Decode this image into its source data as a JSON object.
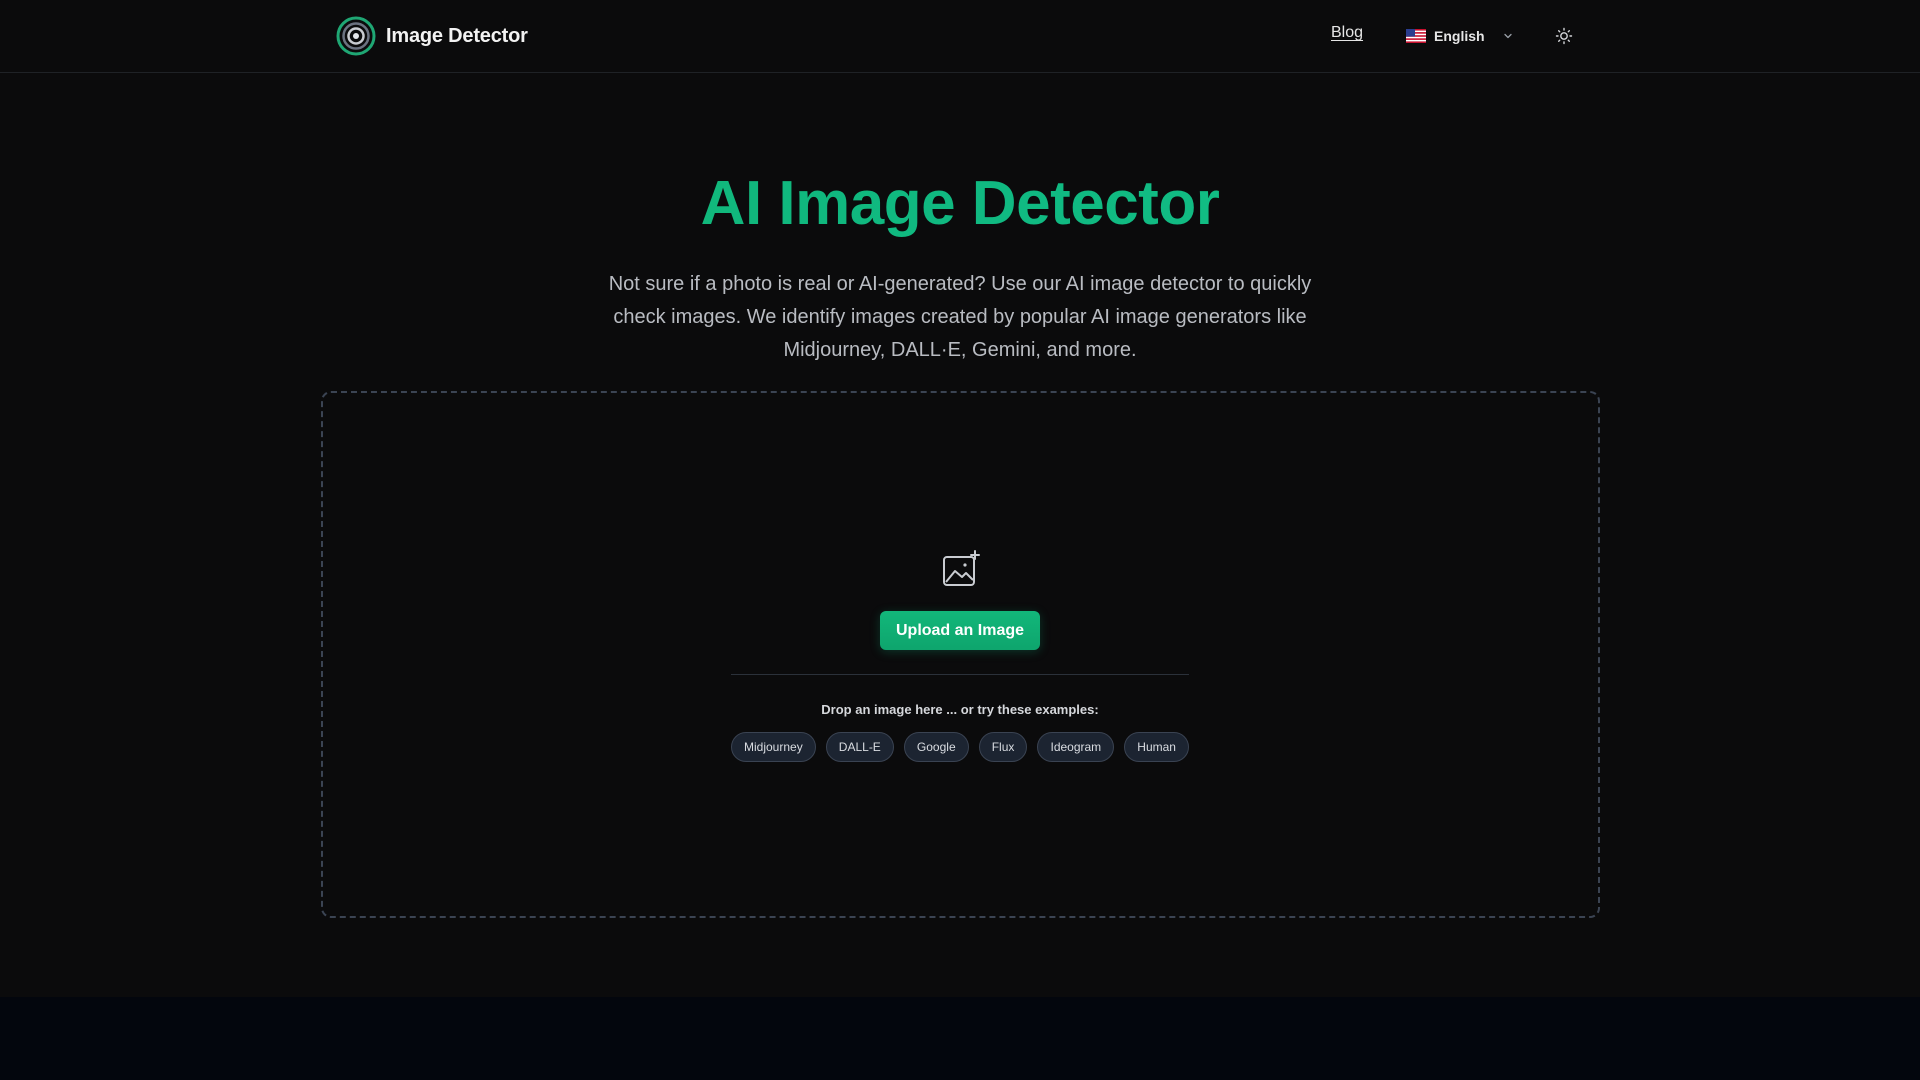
{
  "header": {
    "brand_name": "Image Detector",
    "nav_blog": "Blog",
    "language": "English",
    "icons": {
      "logo": "concentric-circles-logo",
      "flag": "us-flag-icon",
      "chevron": "chevron-down-icon",
      "theme": "sun-icon"
    }
  },
  "hero": {
    "title": "AI Image Detector",
    "subtitle": "Not sure if a photo is real or AI-generated? Use our AI image detector to quickly check images. We identify images created by popular AI image generators like Midjourney, DALL·E, Gemini, and more."
  },
  "upload": {
    "icon": "image-plus-icon",
    "button_label": "Upload an Image",
    "hint": "Drop an image here ... or try these examples:",
    "examples": [
      "Midjourney",
      "DALL-E",
      "Google",
      "Flux",
      "Ideogram",
      "Human"
    ]
  },
  "colors": {
    "accent": "#10b981",
    "background": "#0b0b0c",
    "chip_bg": "#1c2431",
    "dashed_border": "#3b4453"
  }
}
